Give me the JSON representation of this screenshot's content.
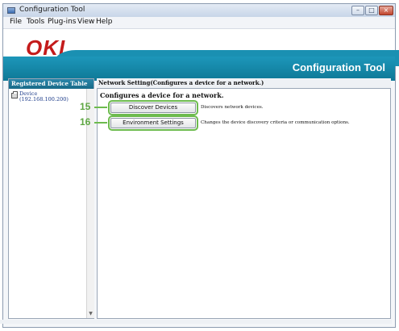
{
  "window": {
    "title": "Configuration Tool",
    "controls": {
      "minimize": "–",
      "maximize": "□",
      "close": "×"
    }
  },
  "menu": [
    "File",
    "Tools",
    "Plug-ins",
    "View",
    "Help"
  ],
  "brand": {
    "logo": "OKI",
    "app_name": "Configuration Tool",
    "accent": "#1686a6",
    "logo_color": "#c41b1b"
  },
  "sidebar": {
    "header": "Registered Device Table",
    "device": {
      "name": "Device",
      "ip": "(192.168.100.200)",
      "icon": "printer-icon"
    }
  },
  "content": {
    "header": "Network Setting(Configures a device for a network.)",
    "title": "Configures a device for a network.",
    "actions": [
      {
        "callout": "15",
        "label": "Discover Devices",
        "description": "Discovers network devices."
      },
      {
        "callout": "16",
        "label": "Environment Settings",
        "description": "Changes the device discovery criteria or communication options."
      }
    ],
    "callout_color": "#6dbb4e"
  }
}
